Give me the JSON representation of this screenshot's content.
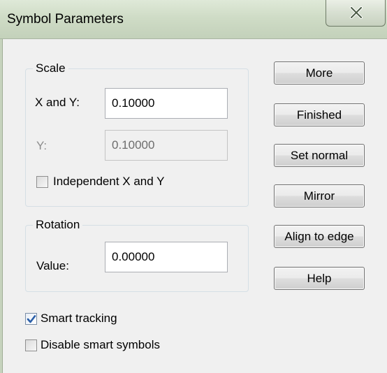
{
  "window": {
    "title": "Symbol Parameters",
    "close_glyph": "X"
  },
  "scale": {
    "group_label": "Scale",
    "xy_label": "X and Y:",
    "xy_value": "0.10000",
    "y_label": "Y:",
    "y_value": "0.10000",
    "independent_label": "Independent X and Y",
    "independent_checked": false
  },
  "rotation": {
    "group_label": "Rotation",
    "value_label": "Value:",
    "value": "0.00000"
  },
  "options": {
    "smart_tracking_label": "Smart tracking",
    "smart_tracking_checked": true,
    "disable_smart_symbols_label": "Disable smart symbols",
    "disable_smart_symbols_checked": false
  },
  "buttons": {
    "more": "More",
    "finished": "Finished",
    "set_normal": "Set normal",
    "mirror": "Mirror",
    "align_to_edge": "Align to edge",
    "help": "Help"
  },
  "colors": {
    "checkmark": "#2a5ea8",
    "titlebar": "#cfdcc6"
  }
}
